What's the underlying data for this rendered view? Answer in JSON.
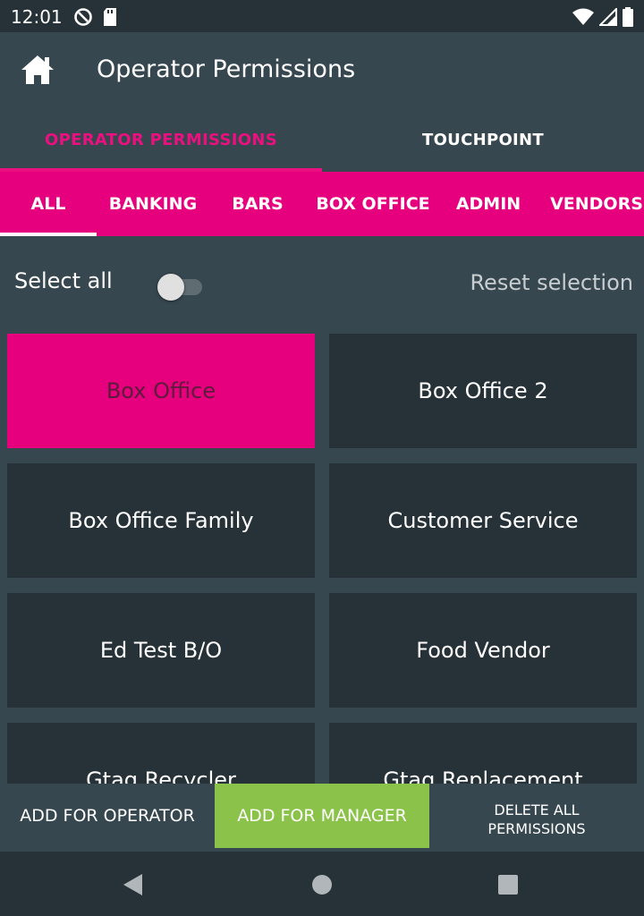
{
  "status_bar": {
    "time": "12:01",
    "icons_left": [
      "no-tracking-icon",
      "sd-card-icon"
    ],
    "icons_right": [
      "wifi-icon",
      "signal-icon",
      "battery-icon"
    ]
  },
  "app_bar": {
    "home_icon": "home-icon",
    "title": "Operator Permissions"
  },
  "top_tabs": [
    {
      "label": "OPERATOR PERMISSIONS",
      "active": true
    },
    {
      "label": "TOUCHPOINT",
      "active": false
    }
  ],
  "category_tabs": [
    {
      "label": "ALL",
      "active": true
    },
    {
      "label": "BANKING",
      "active": false
    },
    {
      "label": "BARS",
      "active": false
    },
    {
      "label": "BOX OFFICE",
      "active": false
    },
    {
      "label": "ADMIN",
      "active": false
    },
    {
      "label": "VENDORS",
      "active": false
    }
  ],
  "selection": {
    "select_all_label": "Select all",
    "select_all_checked": false,
    "reset_label": "Reset selection"
  },
  "permissions": [
    {
      "label": "Box Office",
      "selected": true
    },
    {
      "label": "Box Office 2",
      "selected": false
    },
    {
      "label": "Box Office Family",
      "selected": false
    },
    {
      "label": "Customer Service",
      "selected": false
    },
    {
      "label": "Ed Test B/O",
      "selected": false
    },
    {
      "label": "Food Vendor",
      "selected": false
    },
    {
      "label": "Gtag Recycler",
      "selected": false
    },
    {
      "label": "Gtag Replacement",
      "selected": false
    }
  ],
  "actions": {
    "add_operator": "ADD FOR OPERATOR",
    "add_manager": "ADD FOR MANAGER",
    "delete_all_line1": "DELETE ALL",
    "delete_all_line2": "PERMISSIONS"
  },
  "nav_bar": {
    "icons": [
      "back-icon",
      "home-circle-icon",
      "recents-icon"
    ]
  },
  "colors": {
    "accent": "#e7007d",
    "manager_button": "#8bc34a",
    "background": "#37474f",
    "tile": "#263238"
  }
}
